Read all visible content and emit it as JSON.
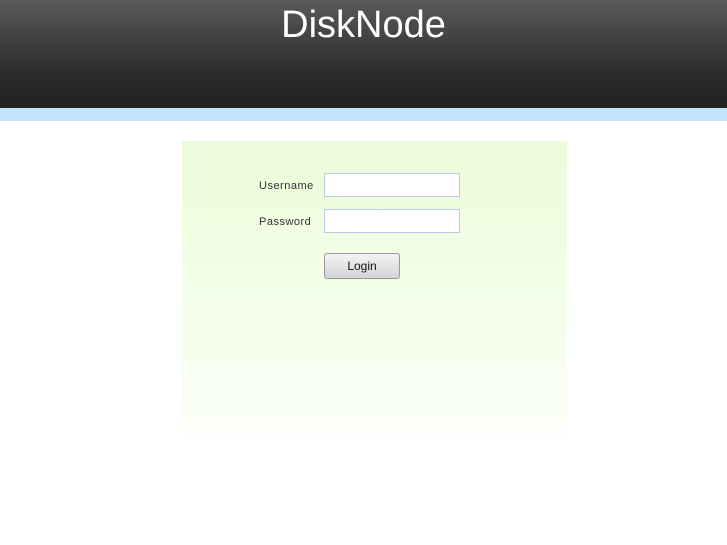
{
  "header": {
    "title": "DiskNode"
  },
  "form": {
    "username_label": "Username",
    "username_value": "",
    "password_label": "Password",
    "password_value": "",
    "login_label": "Login"
  }
}
